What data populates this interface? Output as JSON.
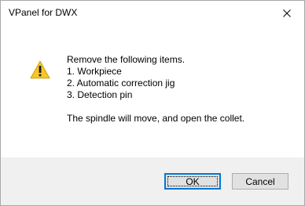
{
  "window": {
    "title": "VPanel for DWX"
  },
  "icons": {
    "close": "close-icon",
    "warning": "warning-icon"
  },
  "message": {
    "lines": [
      "Remove the following items.",
      "1. Workpiece",
      "2. Automatic correction jig",
      "3. Detection pin"
    ],
    "note": "The spindle will move, and open the collet."
  },
  "buttons": {
    "ok_label": "OK",
    "cancel_label": "Cancel"
  },
  "colors": {
    "accent": "#0078d7",
    "warning_fill": "#f7c628",
    "footer_bg": "#f0f0f0"
  }
}
